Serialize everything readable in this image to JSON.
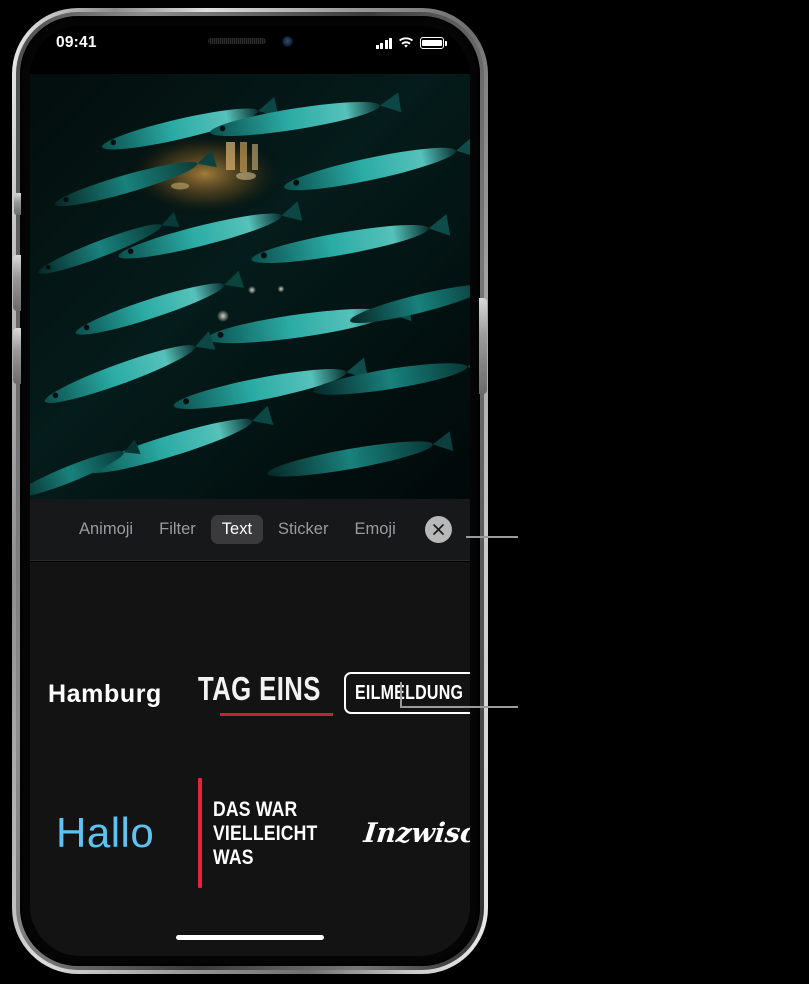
{
  "status_bar": {
    "time": "09:41",
    "cellular_icon": "signal-bars-icon",
    "wifi_icon": "wifi-icon",
    "battery_icon": "battery-full-icon"
  },
  "photo": {
    "description": "underwater photo of a school of fish",
    "alt": "Schwarm Fische unter Wasser"
  },
  "tab_bar": {
    "tabs": [
      {
        "label": "Animoji",
        "active": false
      },
      {
        "label": "Filter",
        "active": false
      },
      {
        "label": "Text",
        "active": true
      },
      {
        "label": "Sticker",
        "active": false
      },
      {
        "label": "Emoji",
        "active": false
      }
    ],
    "close_button": {
      "icon": "close-x-icon",
      "label": "Schließen"
    }
  },
  "text_styles": {
    "row1": [
      {
        "id": "hamburg",
        "text": "Hamburg"
      },
      {
        "id": "tag-eins",
        "text": "TAG EINS",
        "accent_color": "#c42036"
      },
      {
        "id": "eilmeldung",
        "text": "EILMELDUNG"
      }
    ],
    "row2": [
      {
        "id": "hallo",
        "text": "Hallo",
        "color": "#5cc3f2"
      },
      {
        "id": "das-war-vielleicht-was",
        "lines": [
          "DAS WAR",
          "VIELLEICHT",
          "WAS"
        ],
        "accent_color": "#e8213f"
      },
      {
        "id": "inzwischen",
        "text": "Inzwischen"
      }
    ]
  },
  "home_indicator": {
    "label": "home-indicator"
  },
  "callouts": [
    {
      "id": "callout-close-button",
      "target": "close-button"
    },
    {
      "id": "callout-eilmeldung",
      "target": "eilmeldung-style"
    }
  ],
  "colors": {
    "accent_red": "#c42036",
    "accent_crimson": "#e8213f",
    "accent_blue": "#5cc3f2",
    "tabbar_bg": "#17181a",
    "picker_bg": "#131314",
    "leader_line": "#9a9a9a"
  }
}
